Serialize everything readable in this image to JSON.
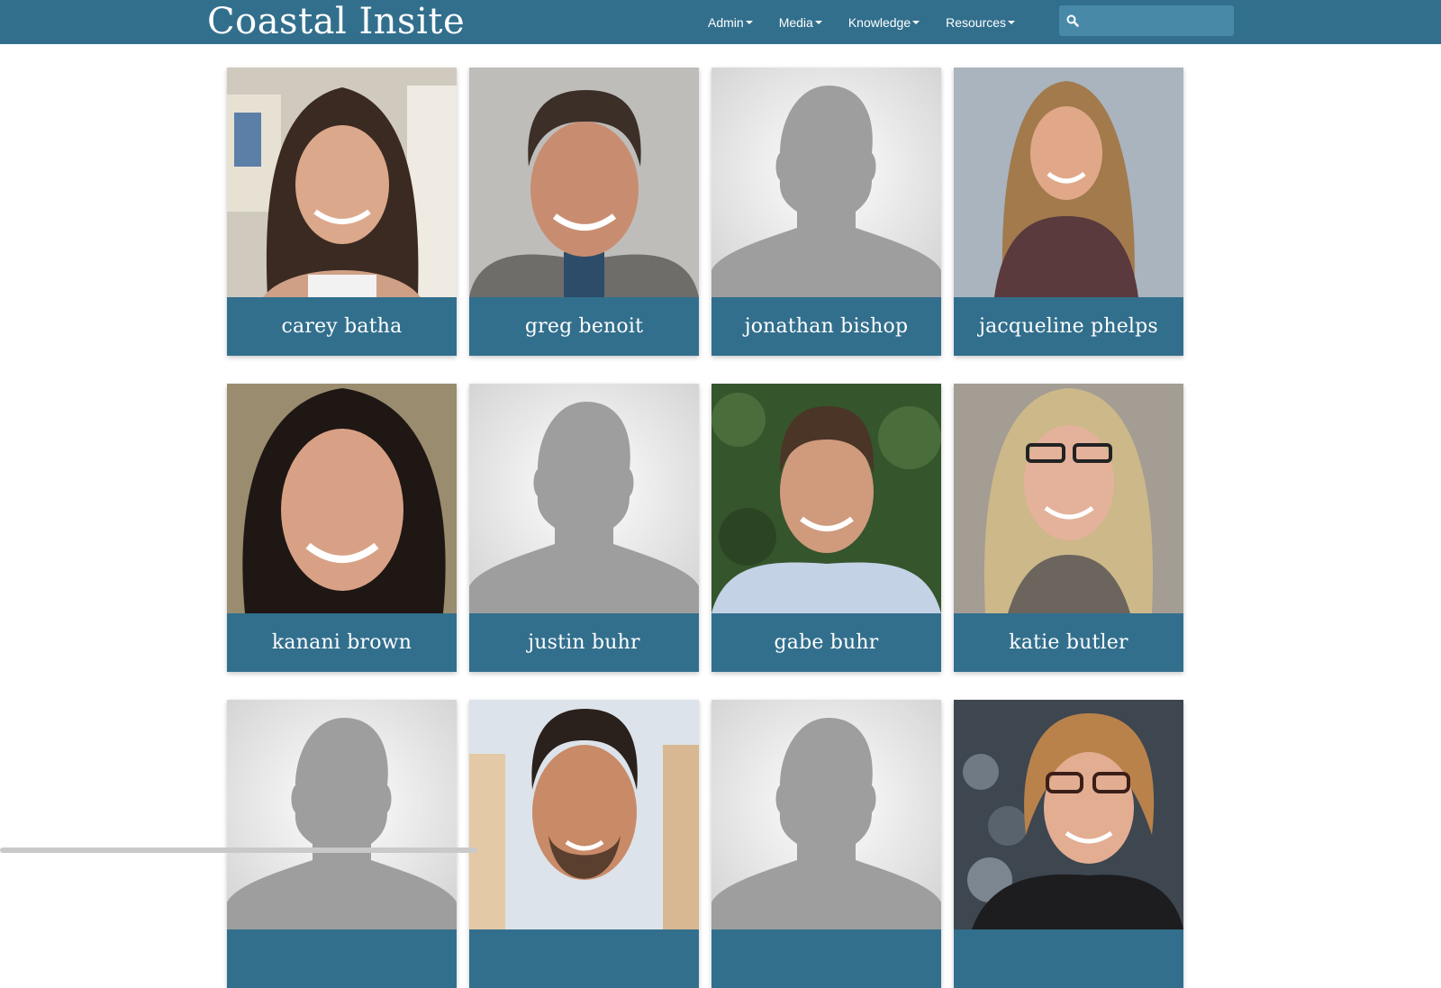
{
  "site": {
    "brand": "Coastal Insite"
  },
  "nav": {
    "items": [
      {
        "label": "Admin"
      },
      {
        "label": "Media"
      },
      {
        "label": "Knowledge"
      },
      {
        "label": "Resources"
      }
    ]
  },
  "search": {
    "placeholder": ""
  },
  "people": [
    {
      "name": "carey batha"
    },
    {
      "name": "greg benoit"
    },
    {
      "name": "jonathan bishop"
    },
    {
      "name": "jacqueline phelps"
    },
    {
      "name": "kanani brown"
    },
    {
      "name": "justin buhr"
    },
    {
      "name": "gabe buhr"
    },
    {
      "name": "katie butler"
    },
    {
      "name": ""
    },
    {
      "name": ""
    },
    {
      "name": ""
    },
    {
      "name": ""
    }
  ],
  "colors": {
    "brand_blue": "#326f8d",
    "search_bg": "#4889a8",
    "placeholder_silhouette": "#9e9e9e"
  }
}
